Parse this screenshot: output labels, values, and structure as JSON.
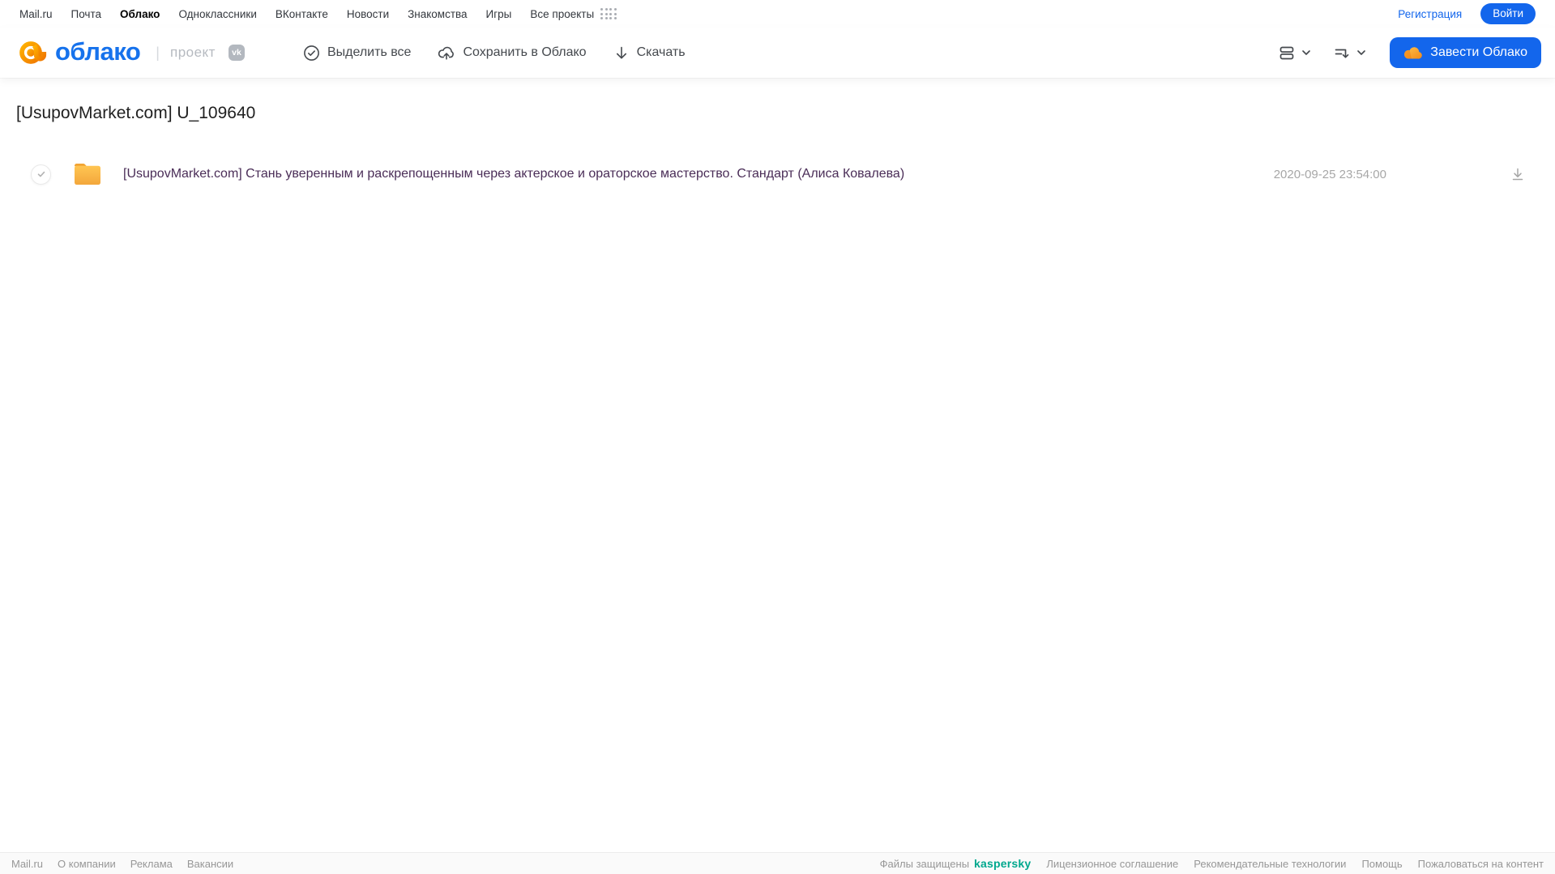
{
  "topnav": {
    "links": [
      "Mail.ru",
      "Почта",
      "Облако",
      "Одноклассники",
      "ВКонтакте",
      "Новости",
      "Знакомства",
      "Игры",
      "Все проекты"
    ],
    "active_link": "Облако",
    "register_label": "Регистрация",
    "login_label": "Войти"
  },
  "header": {
    "logo_text": "облако",
    "project_label": "проект",
    "vk_badge_text": "vk",
    "toolbar": {
      "select_all_label": "Выделить все",
      "save_to_cloud_label": "Сохранить в Облако",
      "download_label": "Скачать"
    },
    "get_cloud_button_label": "Завести Облако"
  },
  "page": {
    "title": "[UsupovMarket.com] U_109640"
  },
  "files": [
    {
      "type": "folder",
      "name": "[UsupovMarket.com] Стань уверенным и раскрепощенным через актерское и ораторское мастерство. Стандарт (Алиса Ковалева)",
      "date": "2020-09-25 23:54:00"
    }
  ],
  "footer": {
    "left_links": [
      "Mail.ru",
      "О компании",
      "Реклама",
      "Вакансии"
    ],
    "protected_label": "Файлы защищены",
    "kaspersky_label": "kaspersky",
    "right_links": [
      "Лицензионное соглашение",
      "Рекомендательные технологии",
      "Помощь",
      "Пожаловаться на контент"
    ]
  },
  "colors": {
    "accent_blue": "#1366ec",
    "logo_blue": "#1672ec",
    "logo_orange": "#f79a1f",
    "folder_yellow": "#ffbe45",
    "visited_link_purple": "#4a2d57",
    "kaspersky_teal": "#00a88e"
  }
}
